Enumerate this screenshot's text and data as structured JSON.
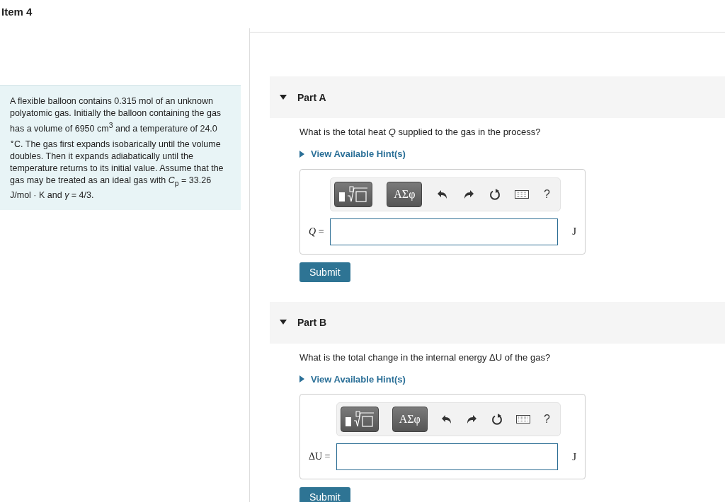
{
  "item_title": "Item 4",
  "problem": "A flexible balloon contains 0.315 mol of an unknown polyatomic gas. Initially the balloon containing the gas has a volume of 6950 cm$^{3}$ and a temperature of 24.0 $^{∘}$C. The gas first expands isobarically until the volume doubles. Then it expands adiabatically until the temperature returns to its initial value. Assume that the gas may be treated as an ideal gas with *C*$_{p}$ = 33.26 J/mol · K and *γ* = 4/3.",
  "parts": [
    {
      "title": "Part A",
      "expanded": true,
      "question": "What is the total heat *Q* supplied to the gas in the process?",
      "hint_link": "View Available Hint(s)",
      "toolbar": {
        "greek": "ΑΣφ",
        "help": "?"
      },
      "answer_label": "*Q* =",
      "unit": "J",
      "submit": "Submit"
    },
    {
      "title": "Part B",
      "expanded": true,
      "question": "What is the total change in the internal energy ΔU of the gas?",
      "hint_link": "View Available Hint(s)",
      "toolbar": {
        "greek": "ΑΣφ",
        "help": "?"
      },
      "answer_label": "ΔU =",
      "unit": "J",
      "submit": "Submit"
    }
  ]
}
